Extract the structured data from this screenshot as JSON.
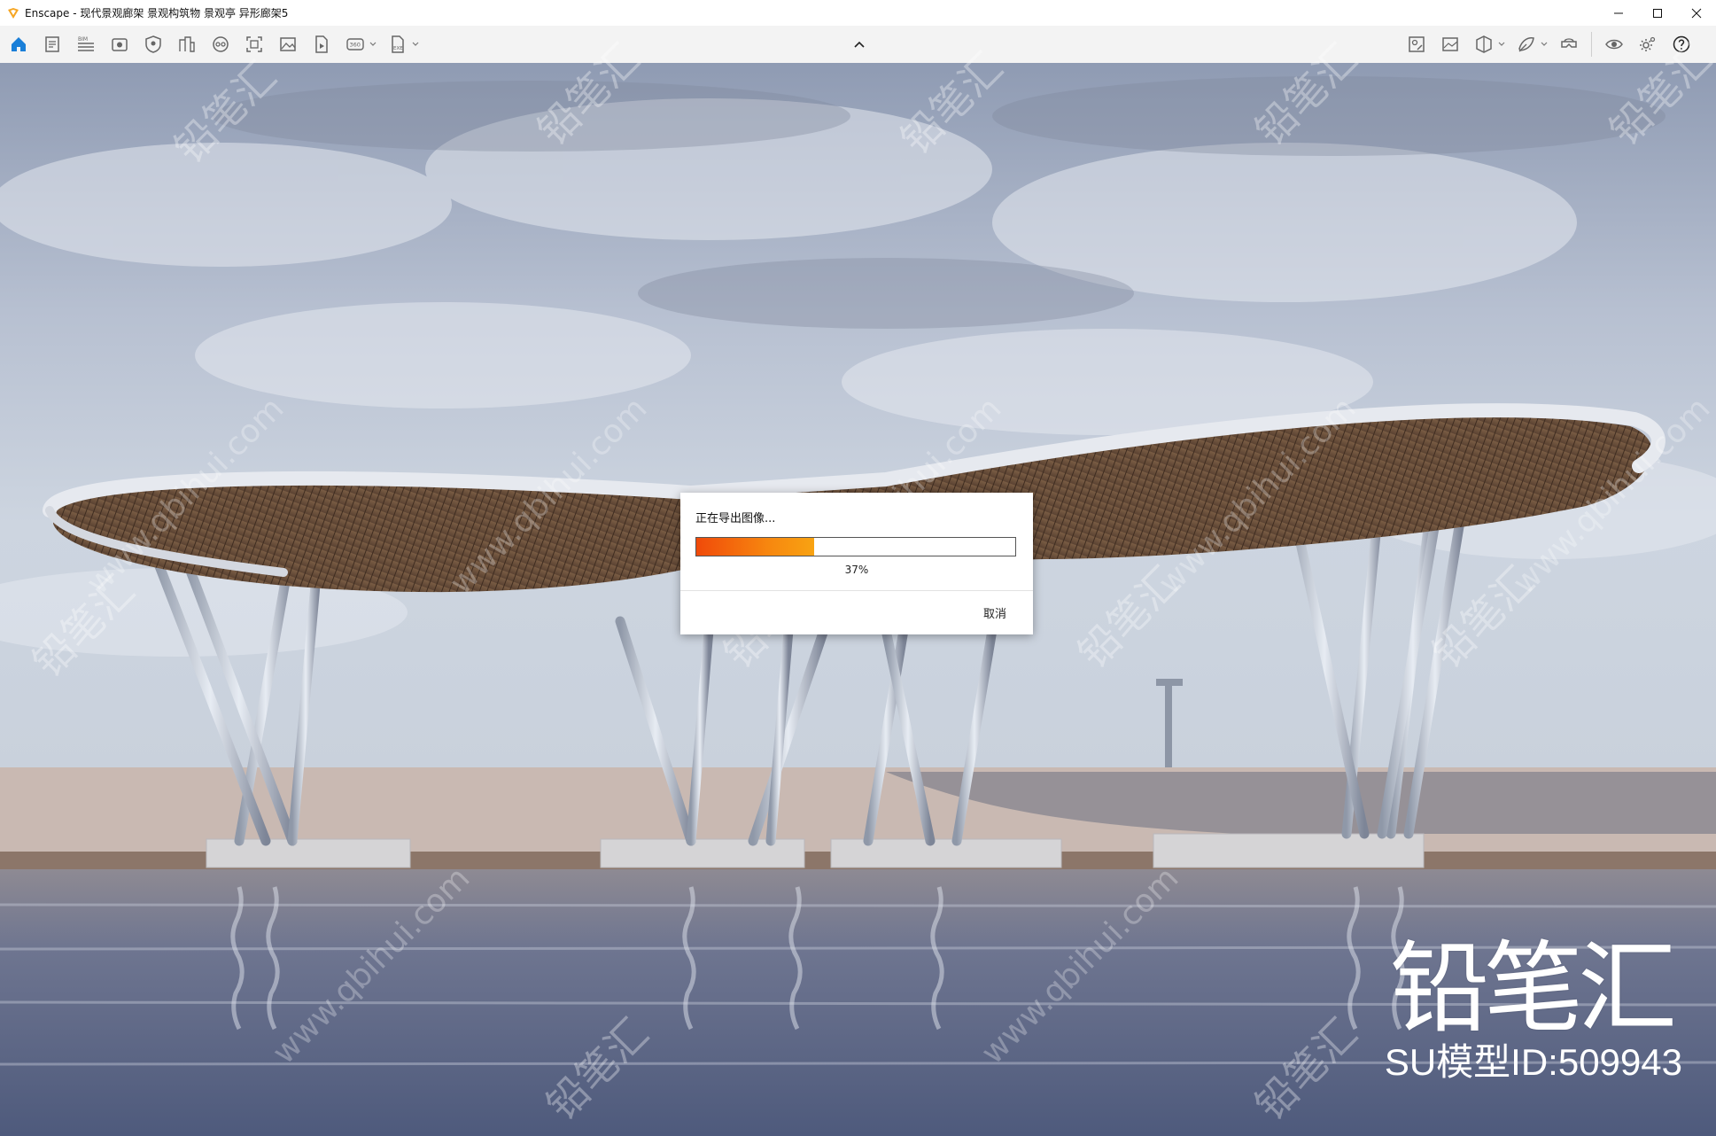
{
  "window": {
    "title": "Enscape - 现代景观廊架 景观构筑物 景观亭 异形廊架5"
  },
  "toolbar": {
    "left_icons": [
      "home-icon",
      "sketch-document-icon",
      "bim-icon",
      "view-icon",
      "safe-frame-icon",
      "batch-icon",
      "panorama-icon",
      "capture-icon",
      "gallery-icon",
      "video-file-icon",
      "360-icon",
      "exe-export-icon"
    ],
    "bim_label": "BIM",
    "pano_label": "360",
    "exe_label": "EXE",
    "right_icons": [
      "asset-library-icon",
      "screenshot-icon",
      "view-management-icon",
      "material-editor-icon",
      "vr-headset-icon",
      "eye-visual-settings-icon",
      "settings-gear-icon",
      "help-icon"
    ]
  },
  "dialog": {
    "title": "正在导出图像...",
    "progress": 37,
    "progress_text": "37%",
    "cancel_label": "取消"
  },
  "overlay": {
    "brand": "铅笔汇",
    "model_id": "SU模型ID:509943",
    "watermark_cn": "铅笔汇",
    "watermark_url": "www.qbihui.com"
  },
  "colors": {
    "accent": "#1a7fd8",
    "progress_start": "#f04a0a",
    "progress_end": "#f8a312"
  }
}
